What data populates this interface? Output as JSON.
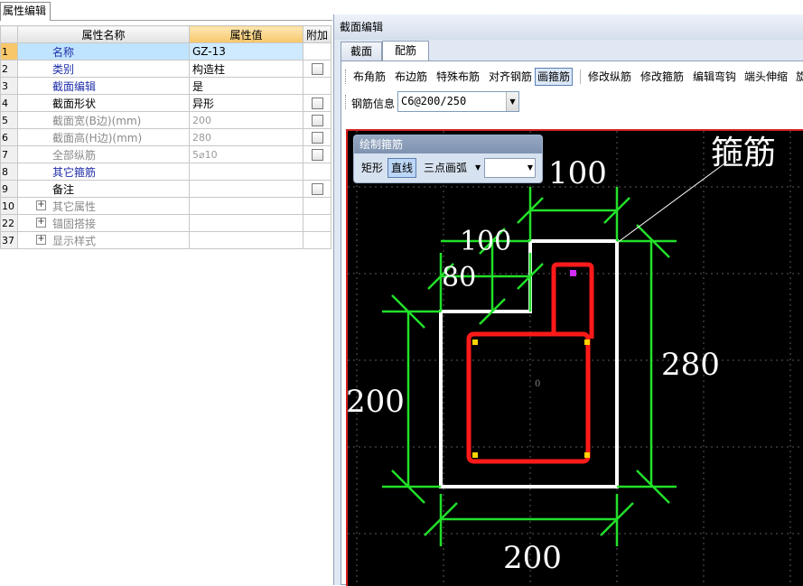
{
  "left_panel": {
    "tab_label": "属性编辑",
    "columns": {
      "name": "属性名称",
      "value": "属性值",
      "extra": "附加"
    },
    "rows": [
      {
        "num": "1",
        "name": "名称",
        "value": "GZ-13",
        "style": "blue",
        "selected": true,
        "checkbox": false
      },
      {
        "num": "2",
        "name": "类别",
        "value": "构造柱",
        "style": "blue",
        "checkbox": true
      },
      {
        "num": "3",
        "name": "截面编辑",
        "value": "是",
        "style": "blue",
        "checkbox": false
      },
      {
        "num": "4",
        "name": "截面形状",
        "value": "异形",
        "style": "normal",
        "checkbox": true
      },
      {
        "num": "5",
        "name": "截面宽(B边)(mm)",
        "value": "200",
        "style": "gray",
        "checkbox": true
      },
      {
        "num": "6",
        "name": "截面高(H边)(mm)",
        "value": "280",
        "style": "gray",
        "checkbox": true
      },
      {
        "num": "7",
        "name": "全部纵筋",
        "value": "5⌀10",
        "style": "gray",
        "checkbox": true
      },
      {
        "num": "8",
        "name": "其它箍筋",
        "value": "",
        "style": "blue",
        "checkbox": false
      },
      {
        "num": "9",
        "name": "备注",
        "value": "",
        "style": "normal",
        "checkbox": true
      },
      {
        "num": "10",
        "name": "其它属性",
        "value": "",
        "style": "gray",
        "expander": "+",
        "checkbox": false
      },
      {
        "num": "22",
        "name": "锚固搭接",
        "value": "",
        "style": "gray",
        "expander": "+",
        "checkbox": false
      },
      {
        "num": "37",
        "name": "显示样式",
        "value": "",
        "style": "gray",
        "expander": "+",
        "checkbox": false
      }
    ]
  },
  "right_panel": {
    "title": "截面编辑",
    "tabs": [
      "截面",
      "配筋"
    ],
    "active_tab": "配筋",
    "toolbar": [
      "布角筋",
      "布边筋",
      "特殊布筋",
      "对齐钢筋",
      "画箍筋",
      "修改纵筋",
      "修改箍筋",
      "编辑弯钩",
      "端头伸缩",
      "旋"
    ],
    "pressed_tool": "画箍筋",
    "rebar_info_label": "钢筋信息",
    "rebar_info_value": "C6@200/250",
    "palette": {
      "title": "绘制箍筋",
      "buttons": [
        "矩形",
        "直线",
        "三点画弧"
      ],
      "pressed": "直线"
    },
    "drawing": {
      "dims": {
        "top_100": "100",
        "step_100": "100",
        "step_80": "80",
        "right_280": "280",
        "left_200": "200",
        "bottom_200": "200"
      },
      "callout": "箍筋",
      "origin_mark": "0",
      "colors": {
        "outline": "#ffffff",
        "dimension": "#22e02a",
        "stirrup": "#ff1a1a",
        "corner_bar": "#ffd400",
        "hook_bar": "#d22cff",
        "grid": "#5a5a5a"
      }
    }
  }
}
